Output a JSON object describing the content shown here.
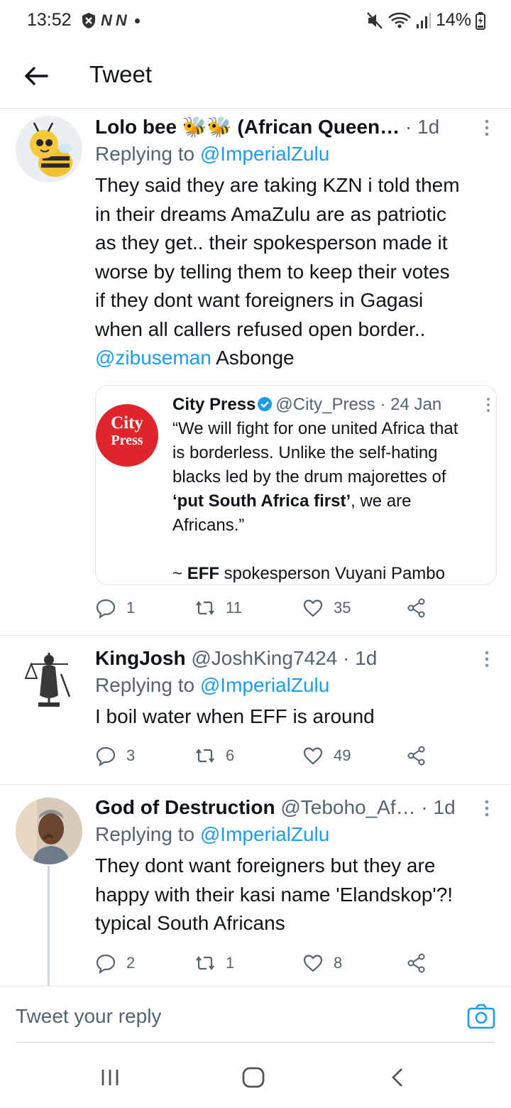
{
  "status_bar": {
    "time": "13:52",
    "notif_icons": [
      "N",
      "N"
    ],
    "battery": "14%"
  },
  "app_bar": {
    "title": "Tweet"
  },
  "tweets": [
    {
      "name": "Lolo bee 🐝🐝 (African Queen…",
      "handle": "",
      "time": "· 1d",
      "replying_prefix": "Replying to ",
      "replying_to": "@ImperialZulu",
      "text_lines": [
        "They said they are taking KZN i told them",
        "in their dreams AmaZulu are as patriotic",
        "as they get.. their spokesperson made it",
        "worse by telling them to keep their votes",
        "if they dont want foreigners in Gagasi",
        "when all callers refused open border.."
      ],
      "text_mention": "@zibuseman",
      "text_tail": " Asbonge",
      "quote": {
        "logo_line1": "City",
        "logo_line2": "Press",
        "name": "City Press",
        "handle": "@City_Press",
        "time": "· 24 Jan",
        "line1": "“We will fight for one united Africa that",
        "line2": "is borderless. Unlike the self-hating",
        "line3": "blacks led by the drum majorettes of",
        "line4_bold": "‘put South Africa first’",
        "line4_rest": ", we are",
        "line5": "Africans.”",
        "attrib_prefix": "~ ",
        "attrib_bold": "EFF",
        "attrib_rest": " spokesperson Vuyani Pambo"
      },
      "replies": "1",
      "retweets": "11",
      "likes": "35"
    },
    {
      "name": "KingJosh",
      "handle": "@JoshKing7424",
      "time": "· 1d",
      "replying_prefix": "Replying to ",
      "replying_to": "@ImperialZulu",
      "text": "I boil water when EFF is around",
      "replies": "3",
      "retweets": "6",
      "likes": "49"
    },
    {
      "name": "God of Destruction",
      "handle": "@Teboho_Af…",
      "time": "· 1d",
      "replying_prefix": "Replying to ",
      "replying_to": "@ImperialZulu",
      "text_lines": [
        "They dont want foreigners but they are",
        "happy with their kasi name 'Elandskop'?!",
        "typical South Africans"
      ],
      "replies": "2",
      "retweets": "1",
      "likes": "8"
    }
  ],
  "reply_bar": {
    "placeholder": "Tweet your reply"
  },
  "colors": {
    "accent": "#1d9bf0",
    "text": "#0f1419",
    "secondary": "#536471",
    "city_press_red": "#e0242b"
  }
}
